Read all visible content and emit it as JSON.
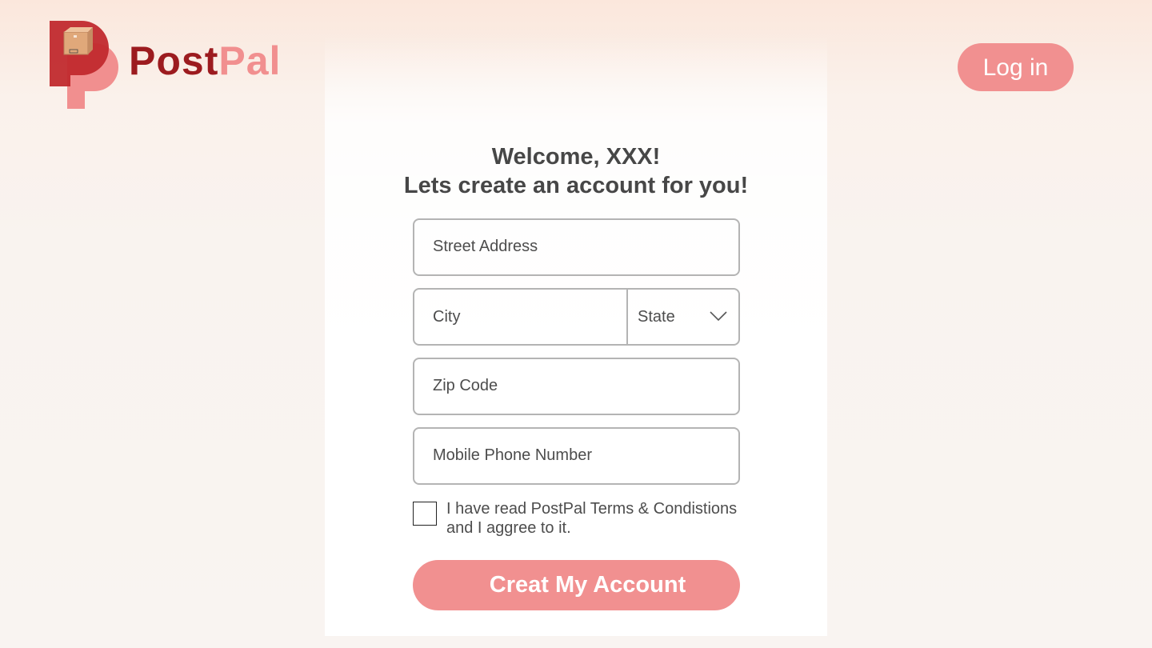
{
  "brand": {
    "name_part1": "Post",
    "name_part2": "Pal",
    "colors": {
      "dark_red": "#9c1b1f",
      "mid_red": "#c12a2e",
      "pink": "#f18f8f"
    }
  },
  "header": {
    "login_label": "Log in"
  },
  "form": {
    "greeting_line1": "Welcome, XXX!",
    "greeting_line2": "Lets create an account for you!",
    "street_placeholder": "Street Address",
    "city_placeholder": "City",
    "state_placeholder": "State",
    "zip_placeholder": "Zip Code",
    "phone_placeholder": "Mobile Phone Number",
    "terms_line1": "I have read PostPal Terms & Condistions",
    "terms_line2": "and I aggree to it.",
    "terms_checked": false,
    "submit_label": "Creat My Account"
  },
  "icons": {
    "logo": "postpal-logo-icon",
    "dropdown": "chevron-down-icon"
  }
}
